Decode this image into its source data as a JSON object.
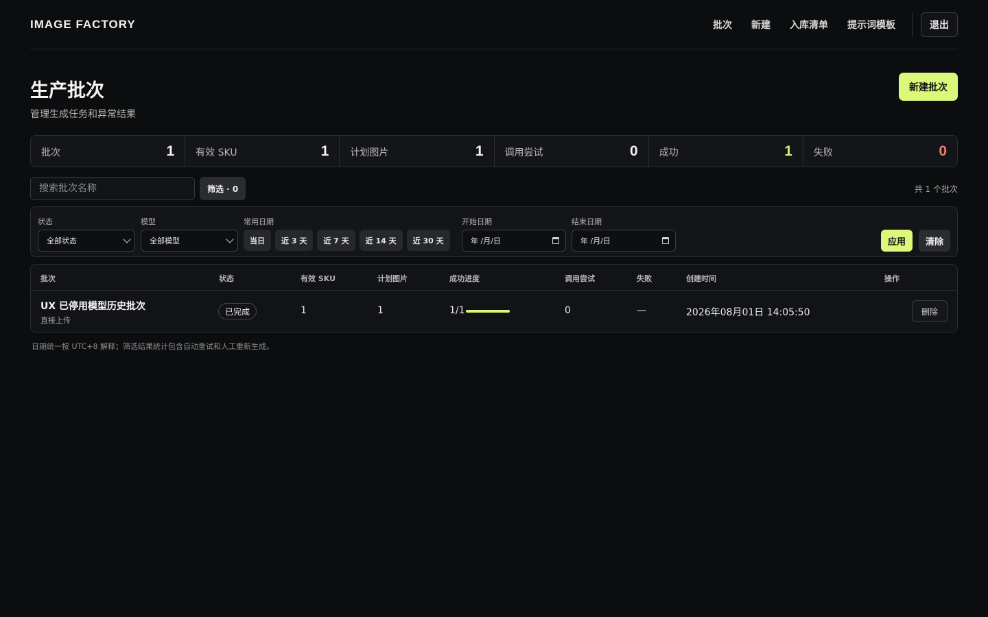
{
  "header": {
    "brand": "IMAGE FACTORY",
    "nav": [
      "批次",
      "新建",
      "入库清单",
      "提示词模板"
    ],
    "logout": "退出"
  },
  "page": {
    "title": "生产批次",
    "subtitle": "管理生成任务和异常结果",
    "new_batch_button": "新建批次"
  },
  "stats": [
    {
      "label": "批次",
      "value": "1",
      "color": "#f4f4f4"
    },
    {
      "label": "有效 SKU",
      "value": "1",
      "color": "#f4f4f4"
    },
    {
      "label": "计划图片",
      "value": "1",
      "color": "#f4f4f4"
    },
    {
      "label": "调用尝试",
      "value": "0",
      "color": "#f4f4f4"
    },
    {
      "label": "成功",
      "value": "1",
      "color": "#d7f56f"
    },
    {
      "label": "失败",
      "value": "0",
      "color": "#f27d6c"
    }
  ],
  "search": {
    "placeholder": "搜索批次名称",
    "filter_chip": "筛选 · 0",
    "total": "共 1 个批次"
  },
  "filters": {
    "status_label": "状态",
    "status_value": "全部状态",
    "model_label": "模型",
    "model_value": "全部模型",
    "quick_label": "常用日期",
    "quick_dates": [
      "当日",
      "近 3 天",
      "近 7 天",
      "近 14 天",
      "近 30 天"
    ],
    "start_label": "开始日期",
    "start_value": "年 /月/日",
    "end_label": "结束日期",
    "end_value": "年 /月/日",
    "apply": "应用",
    "clear": "清除"
  },
  "table": {
    "columns": [
      "批次",
      "状态",
      "有效 SKU",
      "计划图片",
      "成功进度",
      "调用尝试",
      "失败",
      "创建时间",
      "操作"
    ],
    "rows": [
      {
        "name": "UX 已停用模型历史批次",
        "source": "直接上传",
        "status": "已完成",
        "sku": "1",
        "planned": "1",
        "progress_text": "1/1",
        "progress_fraction": 1.0,
        "attempts": "0",
        "failed": "—",
        "created": "2026年08月01日 14:05:50",
        "action": "删除"
      }
    ]
  },
  "footnote": "日期统一按 UTC+8 解释；筛选结果统计包含自动重试和人工重新生成。",
  "colors": {
    "accent": "#dbf87a",
    "success": "#d7f56f",
    "danger": "#f27d6c",
    "background": "#0c0d0f"
  }
}
